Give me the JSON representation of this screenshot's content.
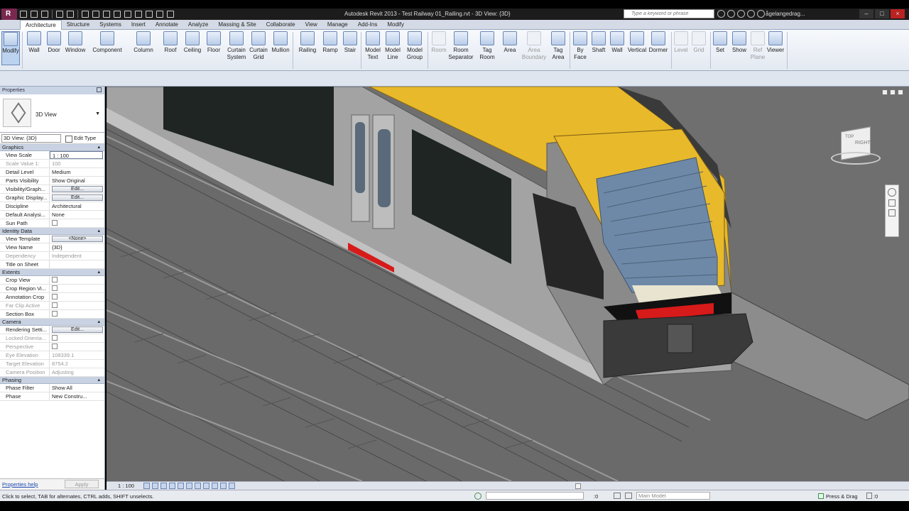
{
  "titlebar": {
    "title": "Autodesk Revit 2013 - Test Railway 01_Railing.rvt - 3D View: {3D}",
    "search_placeholder": "Type a keyword or phrase",
    "user": "ågelangedrag...",
    "min": "–",
    "max": "□",
    "close": "×"
  },
  "tabs": [
    "Architecture",
    "Structure",
    "Systems",
    "Insert",
    "Annotate",
    "Analyze",
    "Massing & Site",
    "Collaborate",
    "View",
    "Manage",
    "Add-Ins",
    "Modify"
  ],
  "ribbon": {
    "modify": "Modify",
    "wall": "Wall",
    "door": "Door",
    "window": "Window",
    "component": "Component",
    "column": "Column",
    "roof": "Roof",
    "ceiling": "Ceiling",
    "floor": "Floor",
    "curtain_system": [
      "Curtain",
      "System"
    ],
    "curtain_grid": [
      "Curtain",
      "Grid"
    ],
    "mullion": "Mullion",
    "railing": "Railing",
    "ramp": "Ramp",
    "stair": "Stair",
    "model_text": [
      "Model",
      "Text"
    ],
    "model_line": [
      "Model",
      "Line"
    ],
    "model_group": [
      "Model",
      "Group"
    ],
    "room": "Room",
    "room_separator": [
      "Room",
      "Separator"
    ],
    "tag_room": [
      "Tag",
      "Room"
    ],
    "area": "Area",
    "area_boundary": [
      "Area",
      "Boundary"
    ],
    "tag_area": [
      "Tag",
      "Area"
    ],
    "by_face": [
      "By",
      "Face"
    ],
    "shaft": "Shaft",
    "wall_opening": "Wall",
    "vertical": "Vertical",
    "dormer": "Dormer",
    "level": "Level",
    "grid": "Grid",
    "set": "Set",
    "show": "Show",
    "ref_plane": [
      "Ref",
      "Plane"
    ],
    "viewer": "Viewer"
  },
  "properties": {
    "header": "Properties",
    "type_name": "3D View",
    "view_selector": "3D View: {3D}",
    "edit_type": "Edit Type",
    "sections": {
      "graphics": "Graphics",
      "identity": "Identity Data",
      "extents": "Extents",
      "camera": "Camera",
      "phasing": "Phasing"
    },
    "graphics": [
      {
        "k": "View Scale",
        "v": "1 : 100"
      },
      {
        "k": "Scale Value   1:",
        "v": "100"
      },
      {
        "k": "Detail Level",
        "v": "Medium"
      },
      {
        "k": "Parts Visibility",
        "v": "Show Original"
      },
      {
        "k": "Visibility/Graph...",
        "v": "Edit..."
      },
      {
        "k": "Graphic Display...",
        "v": "Edit..."
      },
      {
        "k": "Discipline",
        "v": "Architectural"
      },
      {
        "k": "Default Analysi...",
        "v": "None"
      },
      {
        "k": "Sun Path",
        "v": ""
      }
    ],
    "identity": [
      {
        "k": "View Template",
        "v": "<None>"
      },
      {
        "k": "View Name",
        "v": "{3D}"
      },
      {
        "k": "Dependency",
        "v": "Independent"
      },
      {
        "k": "Title on Sheet",
        "v": ""
      }
    ],
    "extents": [
      {
        "k": "Crop View",
        "v": ""
      },
      {
        "k": "Crop Region Vi...",
        "v": ""
      },
      {
        "k": "Annotation Crop",
        "v": ""
      },
      {
        "k": "Far Clip Active",
        "v": ""
      },
      {
        "k": "Section Box",
        "v": ""
      }
    ],
    "camera": [
      {
        "k": "Rendering Setti...",
        "v": "Edit..."
      },
      {
        "k": "Locked Orienta...",
        "v": ""
      },
      {
        "k": "Perspective",
        "v": ""
      },
      {
        "k": "Eye Elevation",
        "v": "108339.1"
      },
      {
        "k": "Target Elevation",
        "v": "8754.2"
      },
      {
        "k": "Camera Position",
        "v": "Adjusting"
      }
    ],
    "phasing": [
      {
        "k": "Phase Filter",
        "v": "Show All"
      },
      {
        "k": "Phase",
        "v": "New Constru..."
      }
    ],
    "help": "Properties help",
    "apply": "Apply"
  },
  "viewcube": {
    "top": "TOP",
    "right": "RIGHT"
  },
  "viewbar": {
    "scale": "1 : 100"
  },
  "status": {
    "hint": "Click to select, TAB for alternates, CTRL adds, SHIFT unselects.",
    "coord": ":0",
    "model": "Main Model",
    "press_drag": "Press & Drag",
    "filter": ":0"
  },
  "colors": {
    "train_yellow": "#e8b92b",
    "train_gray": "#8a8a8a",
    "window_blue": "#6e89a8",
    "red_light": "#d71a1a",
    "ribbon_bg": "#e3e9f2"
  }
}
